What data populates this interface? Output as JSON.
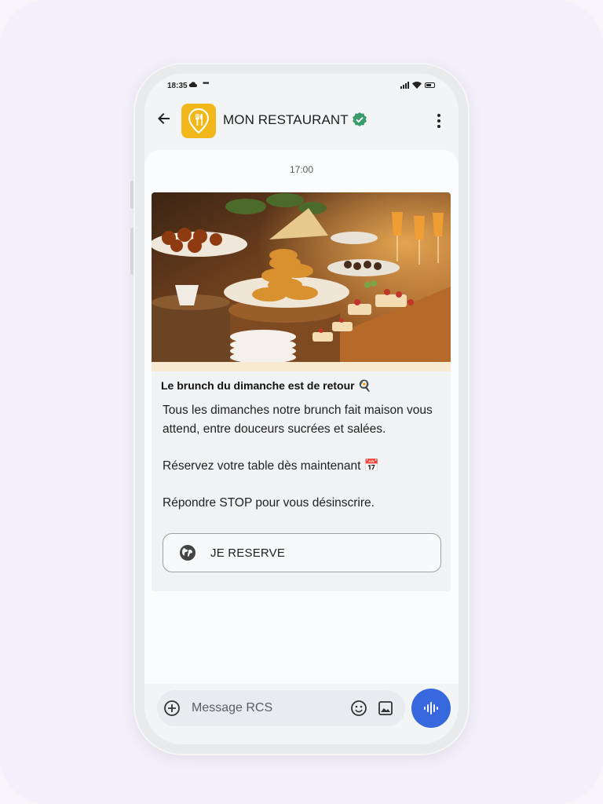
{
  "status_bar": {
    "time": "18:35",
    "more": "•••"
  },
  "header": {
    "title": "MON RESTAURANT",
    "brand_color": "#f2b81b",
    "verified_color": "#3a9b6b"
  },
  "chat": {
    "timestamp": "17:00",
    "card": {
      "title": "Le brunch du dimanche est de retour 🍳",
      "body": [
        "Tous les dimanches notre brunch fait maison vous attend, entre douceurs sucrées et salées.",
        "Réservez votre table dès maintenant 📅",
        "Répondre STOP pour vous désinscrire."
      ],
      "action_label": "JE RESERVE",
      "action_icon": "globe-icon"
    }
  },
  "compose": {
    "placeholder": "Message RCS",
    "send_color": "#3768dd"
  }
}
